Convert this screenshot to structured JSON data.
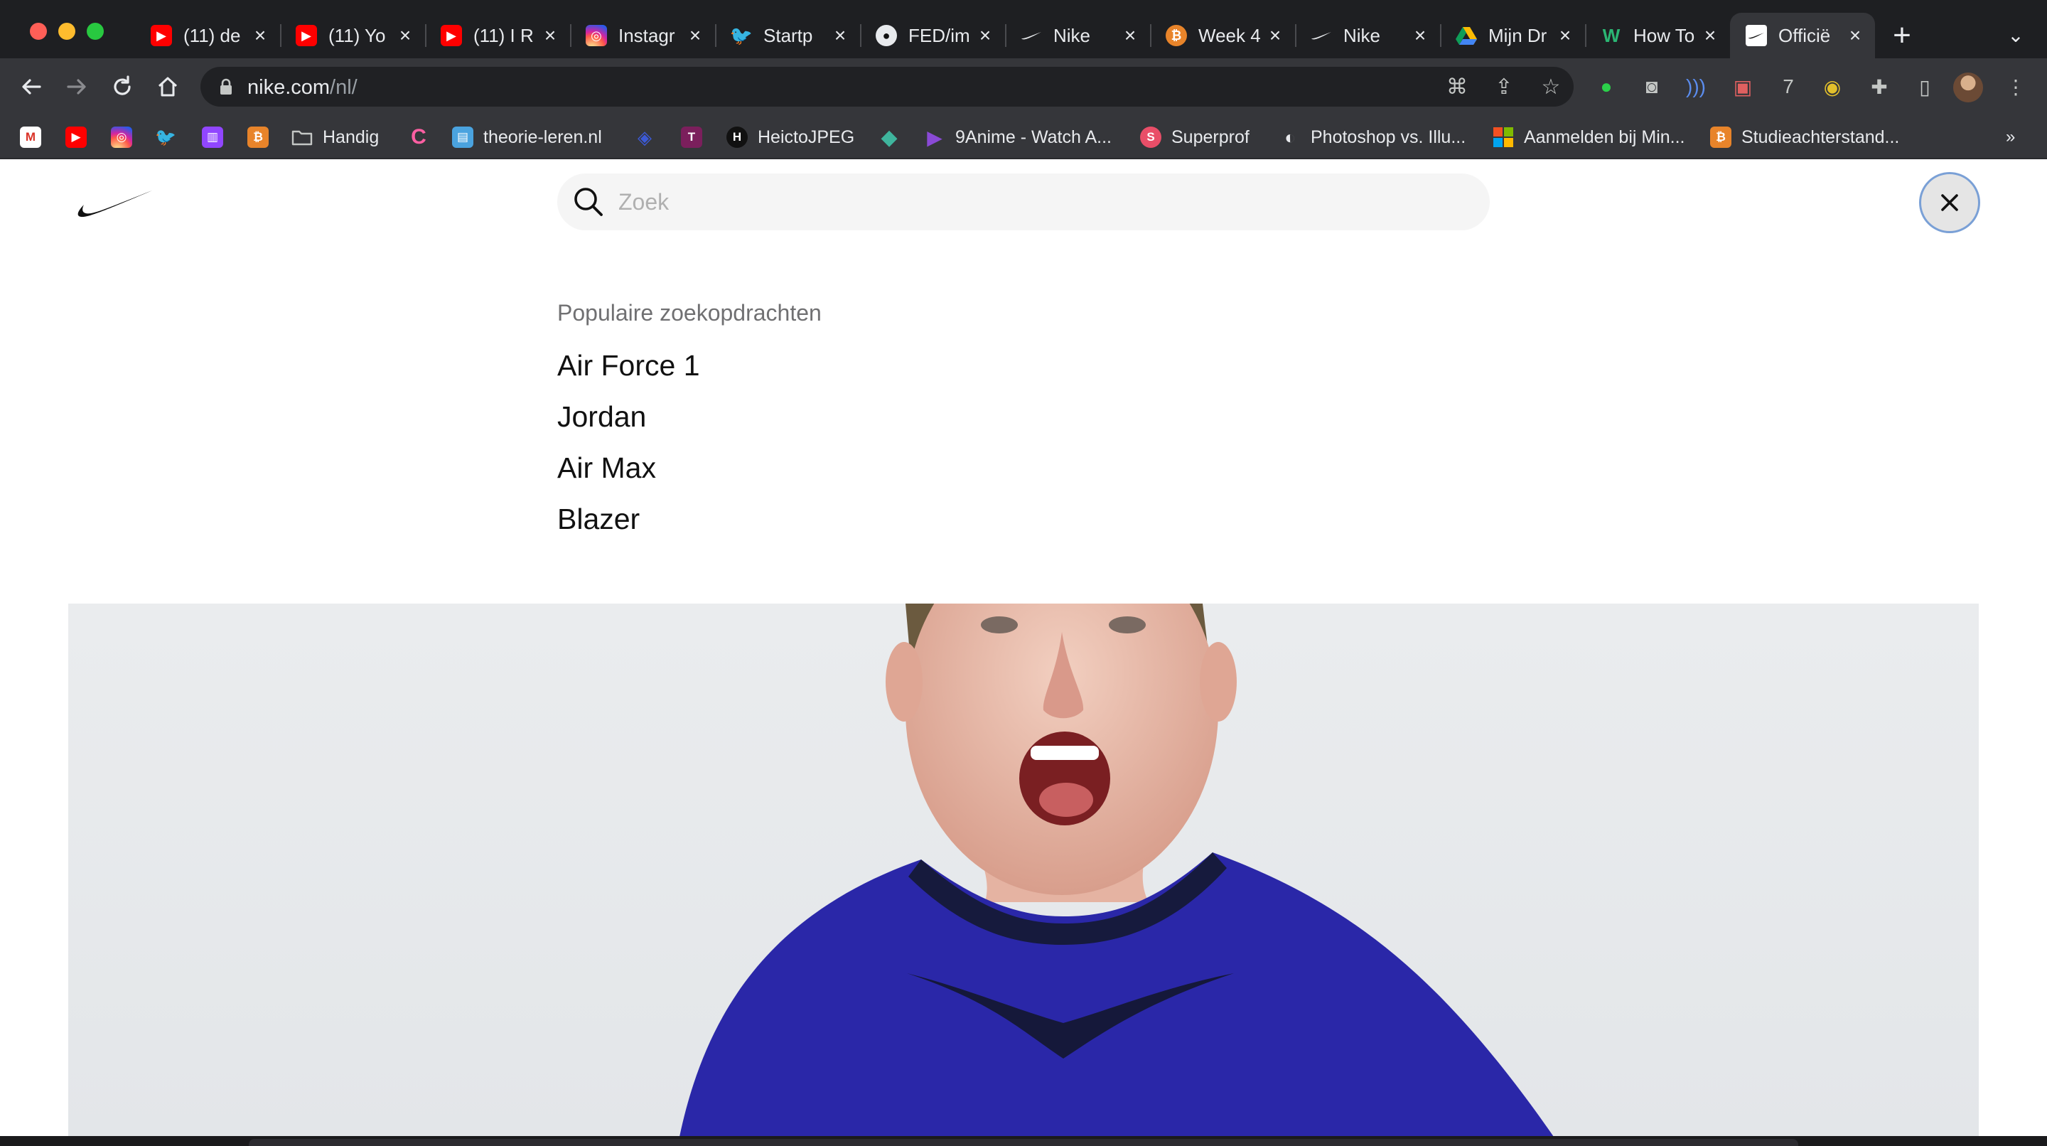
{
  "tabs": [
    {
      "title": "(11) de",
      "favicon": "youtube-icon"
    },
    {
      "title": "(11) Yo",
      "favicon": "youtube-icon"
    },
    {
      "title": "(11) I R",
      "favicon": "youtube-icon"
    },
    {
      "title": "Instagr",
      "favicon": "instagram-icon"
    },
    {
      "title": "Startp",
      "favicon": "twitter-icon"
    },
    {
      "title": "FED/im",
      "favicon": "github-icon"
    },
    {
      "title": "Nike",
      "favicon": "nike-icon"
    },
    {
      "title": "Week 4",
      "favicon": "bitcoin-icon"
    },
    {
      "title": "Nike",
      "favicon": "nike-icon"
    },
    {
      "title": "Mijn Dr",
      "favicon": "google-drive-icon"
    },
    {
      "title": "How To",
      "favicon": "w-icon"
    },
    {
      "title": "Officië",
      "favicon": "nike-icon",
      "active": true
    }
  ],
  "address_bar": {
    "host": "nike.com",
    "path": "/nl/"
  },
  "bookmarks": [
    {
      "label": "",
      "icon": "gmail-icon"
    },
    {
      "label": "",
      "icon": "youtube-icon"
    },
    {
      "label": "",
      "icon": "instagram-icon"
    },
    {
      "label": "",
      "icon": "twitter-icon"
    },
    {
      "label": "",
      "icon": "twitch-icon"
    },
    {
      "label": "",
      "icon": "bitcoin-icon"
    },
    {
      "label": "Handig",
      "icon": "folder-icon"
    },
    {
      "label": "",
      "icon": "canva-icon"
    },
    {
      "label": "theorie-leren.nl",
      "icon": "theorie-icon"
    },
    {
      "label": "",
      "icon": "bookmark-icon"
    },
    {
      "label": "",
      "icon": "t-icon"
    },
    {
      "label": "HeictoJPEG",
      "icon": "h-icon"
    },
    {
      "label": "",
      "icon": "diamond-icon"
    },
    {
      "label": "9Anime - Watch A...",
      "icon": "play-icon"
    },
    {
      "label": "Superprof",
      "icon": "superprof-icon"
    },
    {
      "label": "Photoshop vs. Illu...",
      "icon": "cc-icon"
    },
    {
      "label": "Aanmelden bij Min...",
      "icon": "microsoft-icon"
    },
    {
      "label": "Studieachterstand...",
      "icon": "bitcoin-icon"
    }
  ],
  "search": {
    "placeholder": "Zoek",
    "value": ""
  },
  "popular": {
    "heading": "Populaire zoekopdrachten",
    "items": [
      "Air Force 1",
      "Jordan",
      "Air Max",
      "Blazer"
    ]
  },
  "colors": {
    "accent_focus": "#7aa0d6",
    "text_primary": "#111111",
    "text_secondary": "#707072"
  }
}
